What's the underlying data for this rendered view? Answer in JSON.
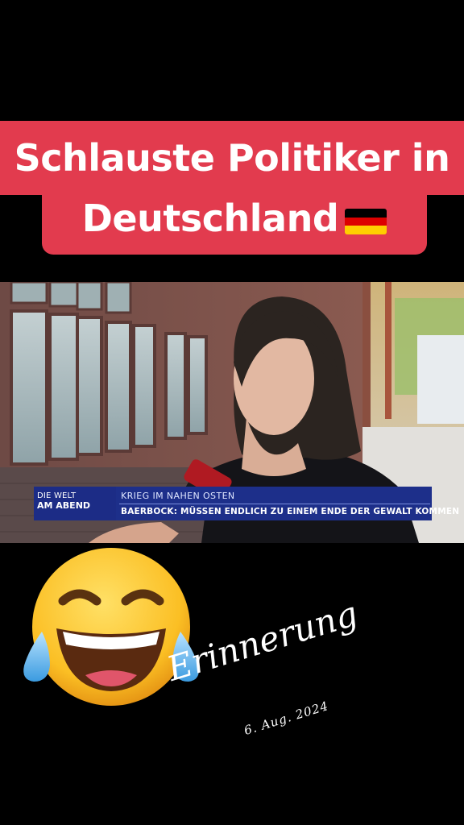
{
  "banner": {
    "line1": "Schlauste Politiker in",
    "line2": "Deutschland",
    "flag_icon": "german-flag-icon",
    "background_color": "#e23b4e",
    "flag_colors": [
      "#000000",
      "#dd0000",
      "#ffce00"
    ]
  },
  "video": {
    "channel_logo_line1": "DIE WELT",
    "channel_logo_line2": "AM ABEND",
    "topic": "KRIEG IM NAHEN OSTEN",
    "headline": "BAERBOCK: MÜSSEN ENDLICH ZU EINEM ENDE DER GEWALT KOMMEN",
    "bar_color": "#1d2f8a"
  },
  "sticker": {
    "emoji_icon": "face-with-tears-of-joy-icon",
    "label": "Erinnerung",
    "date": "6. Aug. 2024"
  }
}
